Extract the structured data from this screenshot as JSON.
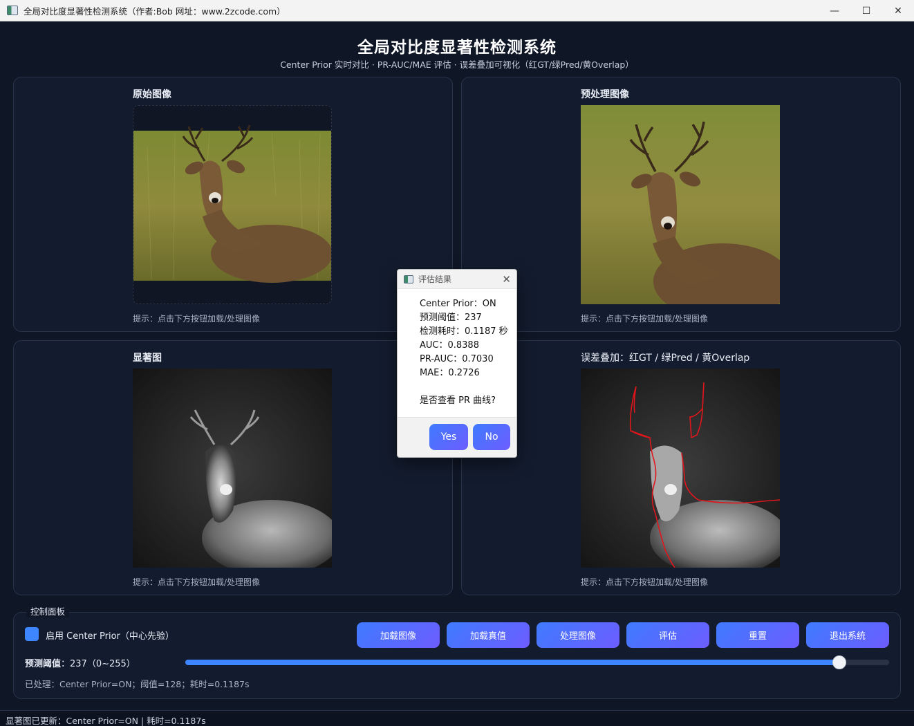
{
  "window": {
    "title": "全局对比度显著性检测系统（作者:Bob 网址：www.2zcode.com）",
    "controls": {
      "minimize": "—",
      "maximize": "☐",
      "close": "✕"
    }
  },
  "header": {
    "title": "全局对比度显著性检测系统",
    "subtitle": "Center Prior 实时对比 · PR-AUC/MAE 评估 · 误差叠加可视化（红GT/绿Pred/黄Overlap）"
  },
  "panels": {
    "original": {
      "title": "原始图像",
      "hint": "提示：点击下方按钮加载/处理图像"
    },
    "preprocessed": {
      "title": "预处理图像",
      "hint": "提示：点击下方按钮加载/处理图像"
    },
    "saliency": {
      "title": "显著图",
      "hint": "提示：点击下方按钮加载/处理图像"
    },
    "overlay": {
      "title": "误差叠加：红GT / 绿Pred / 黄Overlap",
      "hint": "提示：点击下方按钮加载/处理图像"
    }
  },
  "dialog": {
    "title": "评估结果",
    "lines": [
      "Center Prior：ON",
      "预测阈值：237",
      "检测耗时：0.1187 秒",
      "AUC：0.8388",
      "PR-AUC：0.7030",
      "MAE：0.2726",
      "",
      "是否查看 PR 曲线?"
    ],
    "yes_label": "Yes",
    "no_label": "No"
  },
  "controls": {
    "legend": "控制面板",
    "center_prior_label": "启用 Center Prior（中心先验）",
    "center_prior_checked": true,
    "buttons": [
      "加载图像",
      "加载真值",
      "处理图像",
      "评估",
      "重置",
      "退出系统"
    ],
    "threshold_label": "预测阈值",
    "threshold_text": "：237（0~255）",
    "threshold_value": 237,
    "threshold_max": 255,
    "processed_status": "已处理：Center Prior=ON；阈值=128；耗时=0.1187s"
  },
  "status_bar": "显著图已更新：Center Prior=ON | 耗时=0.1187s",
  "colors": {
    "background": "#0f1626",
    "panel": "#131c2e",
    "accent": "#3d86ff",
    "button_gradient_end": "#6d5cff",
    "gt_contour": "#e0161c"
  }
}
